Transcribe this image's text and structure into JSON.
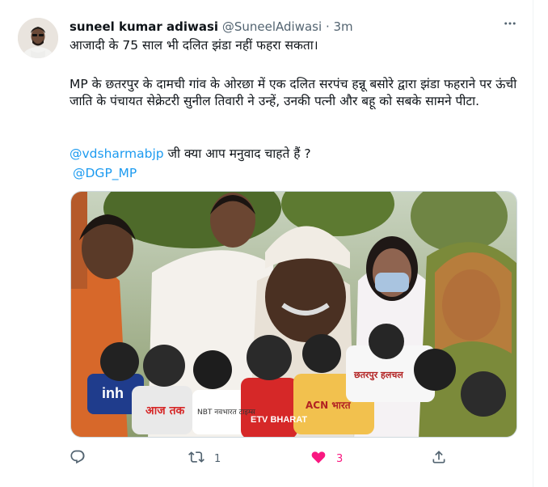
{
  "tweet": {
    "display_name": "suneel kumar adiwasi",
    "handle": "@SuneelAdiwasi",
    "separator": "·",
    "time": "3m",
    "more_icon": "more-horizontal-icon",
    "text": {
      "line1": "आजादी के 75 साल भी दलित झंडा नहीं फहरा सकता।",
      "paragraph2": "MP के छतरपुर के दामची गांव के ओरछा में एक दलित सरपंच हन्नू बसोरे द्वारा झंडा फहराने पर ऊंची जाति के पंचायत सेक्रेटरी सुनील तिवारी ने उन्हें, उनकी पत्नी और बहू को सबके सामने पीटा.",
      "mention1": "@vdsharmabjp",
      "question": " जी क्या आप मनुवाद चाहते हैं ?",
      "mention2": "@DGP_MP"
    },
    "media": {
      "mic_labels": [
        "inh",
        "आज तक",
        "NBT नवभारत टाइम्स",
        "ETV BHARAT",
        "ACN भारत",
        "छतरपुर हलचल"
      ]
    },
    "actions": {
      "reply_icon": "reply-icon",
      "retweet_icon": "retweet-icon",
      "retweet_count": "1",
      "like_icon": "heart-filled-icon",
      "like_count": "3",
      "share_icon": "share-icon"
    },
    "colors": {
      "accent": "#1d9bf0",
      "like": "#f91880",
      "secondary_text": "#536471"
    }
  }
}
